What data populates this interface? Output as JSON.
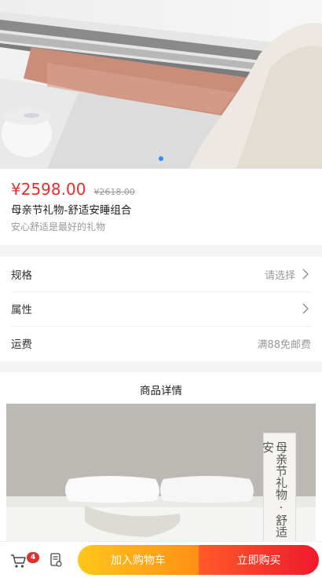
{
  "product": {
    "price": "¥2598.00",
    "original_price": "¥2618.00",
    "title": "母亲节礼物-舒适安睡组合",
    "subtitle": "安心舒适是最好的礼物"
  },
  "carousel": {
    "slide_count": 1,
    "active_index": 0
  },
  "options": [
    {
      "label": "规格",
      "value": "请选择",
      "chevron": "chevron-right-icon"
    },
    {
      "label": "属性",
      "value": "",
      "chevron": "chevron-right-icon"
    },
    {
      "label": "运费",
      "value": "满88免邮费"
    }
  ],
  "detail": {
    "heading": "商品详情",
    "banner_text": "母亲节礼物·舒适安"
  },
  "bottom_bar": {
    "cart_icon": "cart-icon",
    "cart_count": "4",
    "notes_icon": "notes-icon",
    "add_to_cart": "加入购物车",
    "buy_now": "立即购买"
  },
  "colors": {
    "price": "#e0302c",
    "add_to_cart_gradient": [
      "#ffc61a",
      "#ff8f15"
    ],
    "buy_now_gradient": [
      "#ff5a2a",
      "#f0192c"
    ],
    "carousel_active_dot": "#2f8cff"
  }
}
